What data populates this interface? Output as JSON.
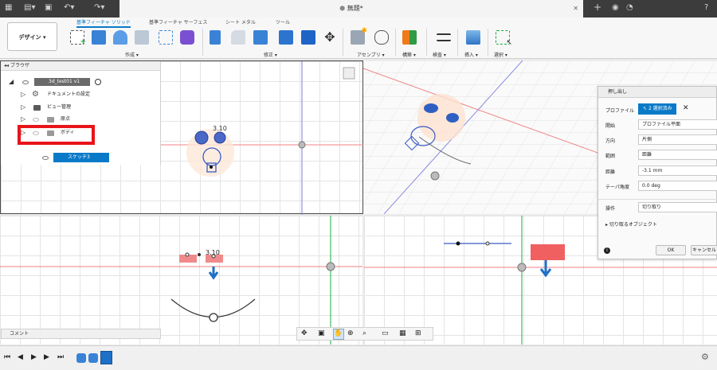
{
  "window": {
    "title": "無題*"
  },
  "toolbar": {
    "design_label": "デザイン ▾",
    "tabs": [
      "基準フィーチャ ソリッド",
      "基準フィーチャ サーフェス",
      "シート メタル",
      "ツール"
    ],
    "groups": [
      "作成 ▾",
      "修正 ▾",
      "アセンブリ ▾",
      "構築 ▾",
      "検査 ▾",
      "挿入 ▾",
      "選択 ▾"
    ]
  },
  "browser": {
    "title": "ブラウザ",
    "root": "3d_test01 v1",
    "items": [
      "ドキュメントの設定",
      "ビュー管理",
      "原点",
      "ボディ"
    ],
    "sketch": "スケッチ3"
  },
  "dialog": {
    "title": "押し出し",
    "profile_label": "プロファイル",
    "profile_value": "2 選択済み",
    "start_label": "開始",
    "start_value": "プロファイル平面",
    "direction_label": "方向",
    "direction_value": "片側",
    "extent_label": "範囲",
    "extent_value": "距離",
    "distance_label": "距離",
    "distance_value": "-3.1 mm",
    "taper_label": "テーパ角度",
    "taper_value": "0.0 deg",
    "operation_label": "操作",
    "operation_value": "切り取り",
    "objects_label": "切り取るオブジェクト",
    "ok": "OK",
    "cancel": "キャンセル"
  },
  "viewport": {
    "dim_label": "3.10"
  },
  "comment": {
    "label": "コメント"
  },
  "colors": {
    "accent": "#0a7ac8",
    "highlight_box": "#e8141a",
    "sketch": "#3b5bc4",
    "profile_fill": "#f08a8a"
  }
}
